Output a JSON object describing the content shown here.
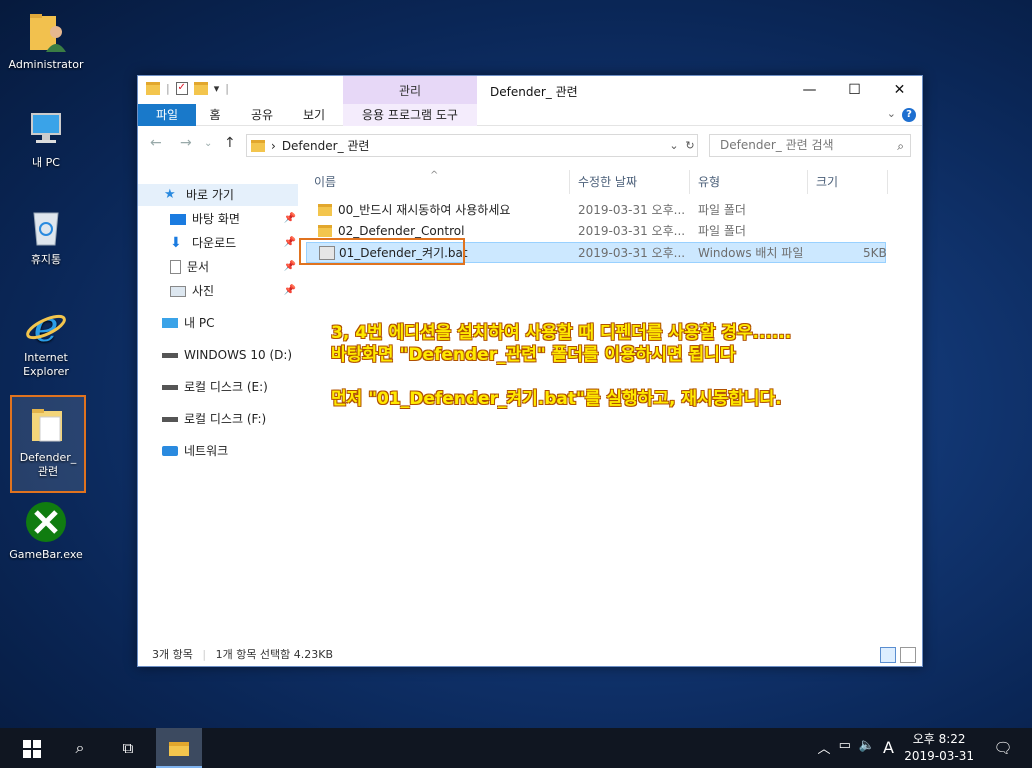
{
  "desktop": {
    "icons": [
      {
        "label": "Administrator"
      },
      {
        "label": "내 PC"
      },
      {
        "label": "휴지통"
      },
      {
        "label": "Internet Explorer"
      },
      {
        "label": "Defender_ 관련"
      },
      {
        "label": "GameBar.exe"
      }
    ]
  },
  "window": {
    "title": "Defender_ 관련",
    "context_tab_head": "관리",
    "ribbon_tabs": [
      "파일",
      "홈",
      "공유",
      "보기",
      "응용 프로그램 도구"
    ],
    "address": "Defender_ 관련",
    "search_placeholder": "Defender_ 관련 검색",
    "sidebar": [
      {
        "label": "바로 가기"
      },
      {
        "label": "바탕 화면"
      },
      {
        "label": "다운로드"
      },
      {
        "label": "문서"
      },
      {
        "label": "사진"
      },
      {
        "label": "내 PC"
      },
      {
        "label": "WINDOWS 10 (D:)"
      },
      {
        "label": "로컬 디스크 (E:)"
      },
      {
        "label": "로컬 디스크 (F:)"
      },
      {
        "label": "네트워크"
      }
    ],
    "columns": [
      "이름",
      "수정한 날짜",
      "유형",
      "크기"
    ],
    "files": [
      {
        "name": "00_반드시 재시동하여 사용하세요",
        "date": "2019-03-31 오후...",
        "type": "파일 폴더",
        "size": ""
      },
      {
        "name": "02_Defender_Control",
        "date": "2019-03-31 오후...",
        "type": "파일 폴더",
        "size": ""
      },
      {
        "name": "01_Defender_켜기.bat",
        "date": "2019-03-31 오후...",
        "type": "Windows 배치 파일",
        "size": "5KB"
      }
    ],
    "status": {
      "count": "3개 항목",
      "selection": "1개 항목 선택함 4.23KB"
    }
  },
  "annotation": {
    "line1": "3, 4번 에디션을 설치하여 사용할 때 디펜더를 사용할 경우......",
    "line2": "바탕화면 \"Defender_관련\" 폴더를 이용하시면 됩니다",
    "line3": "먼저 \"01_Defender_켜기.bat\"를 실행하고, 재시동합니다."
  },
  "taskbar": {
    "time": "오후 8:22",
    "date": "2019-03-31",
    "ime": "A"
  },
  "colors": {
    "accent": "#1979ca",
    "highlight_border": "#e0731f",
    "annotation_text": "#ffea00"
  }
}
